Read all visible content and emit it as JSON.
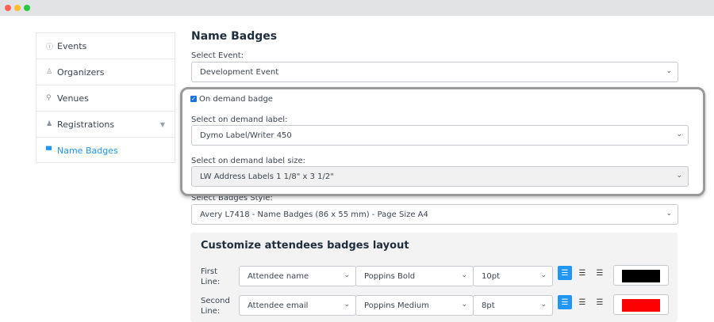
{
  "window": {
    "dots": [
      "#ff5f57",
      "#febc2e",
      "#28c840"
    ]
  },
  "sidebar": {
    "items": [
      {
        "label": "Events",
        "icon": "info-circle-icon",
        "glyph": "ⓘ"
      },
      {
        "label": "Organizers",
        "icon": "user-icon",
        "glyph": "♙"
      },
      {
        "label": "Venues",
        "icon": "map-pin-icon",
        "glyph": "⚲"
      },
      {
        "label": "Registrations",
        "icon": "users-icon",
        "glyph": "♟"
      },
      {
        "label": "Name Badges",
        "icon": "printer-icon",
        "glyph": "▀",
        "active": true
      }
    ],
    "chevron": "▼"
  },
  "main": {
    "title": "Name Badges",
    "select_event_label": "Select Event:",
    "select_event_value": "Development Event",
    "on_demand_label": "On demand badge",
    "on_demand_checked": true,
    "on_demand_label_select_label": "Select on demand label:",
    "on_demand_label_value": "Dymo Label/Writer 450",
    "on_demand_size_label": "Select on demand label size:",
    "on_demand_size_value": "LW Address Labels 1 1/8\" x 3 1/2\"",
    "badges_style_label": "Select Badges Style:",
    "badges_style_value": "Avery L7418 - Name Badges (86 x 55 mm) - Page Size A4"
  },
  "layout_panel": {
    "title": "Customize attendees badges layout",
    "rows": [
      {
        "label": "First Line:",
        "field": "Attendee name",
        "font": "Poppins Bold",
        "size": "10pt",
        "color": "#000000"
      },
      {
        "label": "Second Line:",
        "field": "Attendee email",
        "font": "Poppins Medium",
        "size": "8pt",
        "color": "#ff0000"
      }
    ]
  },
  "colors": {
    "accent": "#2196f3"
  }
}
